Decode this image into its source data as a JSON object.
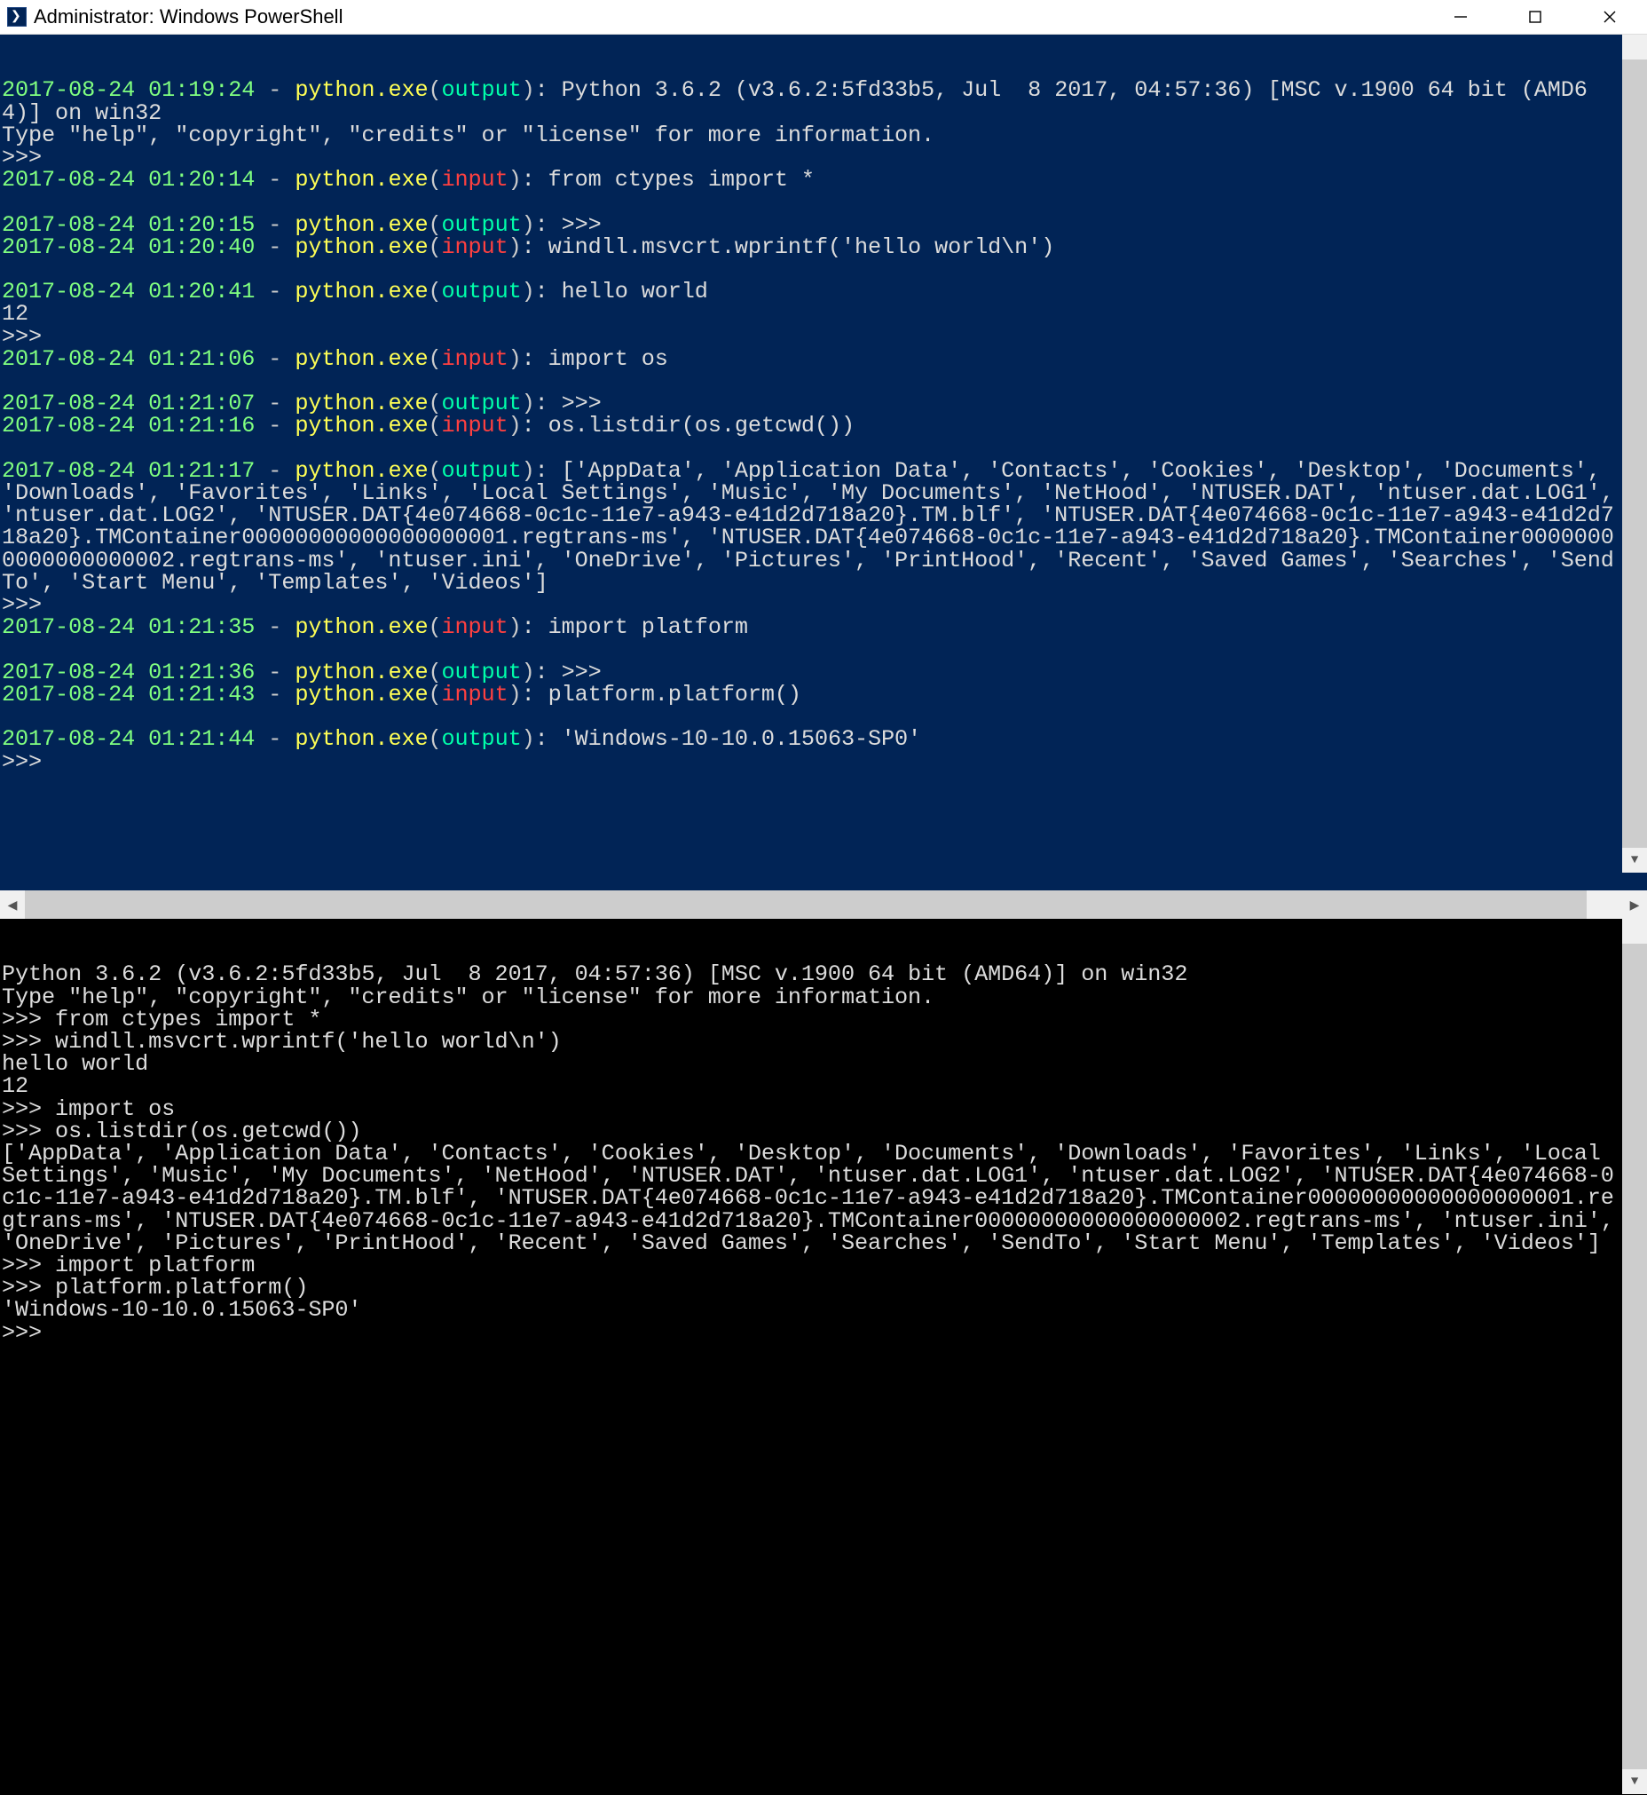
{
  "window": {
    "title": "Administrator: Windows PowerShell"
  },
  "top": {
    "lines": [
      {
        "t": "row",
        "ts": "2017-08-24 01:19:24",
        "prog": "python.exe",
        "io": "output",
        "msg": ": Python 3.6.2 (v3.6.2:5fd33b5, Jul  8 2017, 04:57:36) [MSC v.1900 64 bit (AMD64)] on win32"
      },
      {
        "t": "raw",
        "msg": "Type \"help\", \"copyright\", \"credits\" or \"license\" for more information."
      },
      {
        "t": "raw",
        "msg": ">>> "
      },
      {
        "t": "row",
        "ts": "2017-08-24 01:20:14",
        "prog": "python.exe",
        "io": "input",
        "msg": ": from ctypes import *"
      },
      {
        "t": "raw",
        "msg": ""
      },
      {
        "t": "row",
        "ts": "2017-08-24 01:20:15",
        "prog": "python.exe",
        "io": "output",
        "msg": ": >>> "
      },
      {
        "t": "row",
        "ts": "2017-08-24 01:20:40",
        "prog": "python.exe",
        "io": "input",
        "msg": ": windll.msvcrt.wprintf('hello world\\n')"
      },
      {
        "t": "raw",
        "msg": ""
      },
      {
        "t": "row",
        "ts": "2017-08-24 01:20:41",
        "prog": "python.exe",
        "io": "output",
        "msg": ": hello world"
      },
      {
        "t": "raw",
        "msg": "12"
      },
      {
        "t": "raw",
        "msg": ">>> "
      },
      {
        "t": "row",
        "ts": "2017-08-24 01:21:06",
        "prog": "python.exe",
        "io": "input",
        "msg": ": import os"
      },
      {
        "t": "raw",
        "msg": ""
      },
      {
        "t": "row",
        "ts": "2017-08-24 01:21:07",
        "prog": "python.exe",
        "io": "output",
        "msg": ": >>> "
      },
      {
        "t": "row",
        "ts": "2017-08-24 01:21:16",
        "prog": "python.exe",
        "io": "input",
        "msg": ": os.listdir(os.getcwd())"
      },
      {
        "t": "raw",
        "msg": ""
      },
      {
        "t": "row",
        "ts": "2017-08-24 01:21:17",
        "prog": "python.exe",
        "io": "output",
        "msg": ": ['AppData', 'Application Data', 'Contacts', 'Cookies', 'Desktop', 'Documents', 'Downloads', 'Favorites', 'Links', 'Local Settings', 'Music', 'My Documents', 'NetHood', 'NTUSER.DAT', 'ntuser.dat.LOG1', 'ntuser.dat.LOG2', 'NTUSER.DAT{4e074668-0c1c-11e7-a943-e41d2d718a20}.TM.blf', 'NTUSER.DAT{4e074668-0c1c-11e7-a943-e41d2d718a20}.TMContainer00000000000000000001.regtrans-ms', 'NTUSER.DAT{4e074668-0c1c-11e7-a943-e41d2d718a20}.TMContainer00000000000000000002.regtrans-ms', 'ntuser.ini', 'OneDrive', 'Pictures', 'PrintHood', 'Recent', 'Saved Games', 'Searches', 'SendTo', 'Start Menu', 'Templates', 'Videos']"
      },
      {
        "t": "raw",
        "msg": ">>> "
      },
      {
        "t": "row",
        "ts": "2017-08-24 01:21:35",
        "prog": "python.exe",
        "io": "input",
        "msg": ": import platform"
      },
      {
        "t": "raw",
        "msg": ""
      },
      {
        "t": "row",
        "ts": "2017-08-24 01:21:36",
        "prog": "python.exe",
        "io": "output",
        "msg": ": >>> "
      },
      {
        "t": "row",
        "ts": "2017-08-24 01:21:43",
        "prog": "python.exe",
        "io": "input",
        "msg": ": platform.platform()"
      },
      {
        "t": "raw",
        "msg": ""
      },
      {
        "t": "row",
        "ts": "2017-08-24 01:21:44",
        "prog": "python.exe",
        "io": "output",
        "msg": ": 'Windows-10-10.0.15063-SP0'"
      },
      {
        "t": "raw",
        "msg": ">>> "
      }
    ]
  },
  "bot": {
    "lines": [
      "Python 3.6.2 (v3.6.2:5fd33b5, Jul  8 2017, 04:57:36) [MSC v.1900 64 bit (AMD64)] on win32",
      "Type \"help\", \"copyright\", \"credits\" or \"license\" for more information.",
      ">>> from ctypes import *",
      ">>> windll.msvcrt.wprintf('hello world\\n')",
      "hello world",
      "12",
      ">>> import os",
      ">>> os.listdir(os.getcwd())",
      "['AppData', 'Application Data', 'Contacts', 'Cookies', 'Desktop', 'Documents', 'Downloads', 'Favorites', 'Links', 'Local Settings', 'Music', 'My Documents', 'NetHood', 'NTUSER.DAT', 'ntuser.dat.LOG1', 'ntuser.dat.LOG2', 'NTUSER.DAT{4e074668-0c1c-11e7-a943-e41d2d718a20}.TM.blf', 'NTUSER.DAT{4e074668-0c1c-11e7-a943-e41d2d718a20}.TMContainer00000000000000000001.regtrans-ms', 'NTUSER.DAT{4e074668-0c1c-11e7-a943-e41d2d718a20}.TMContainer00000000000000000002.regtrans-ms', 'ntuser.ini', 'OneDrive', 'Pictures', 'PrintHood', 'Recent', 'Saved Games', 'Searches', 'SendTo', 'Start Menu', 'Templates', 'Videos']",
      ">>> import platform",
      ">>> platform.platform()",
      "'Windows-10-10.0.15063-SP0'",
      ">>> "
    ]
  }
}
